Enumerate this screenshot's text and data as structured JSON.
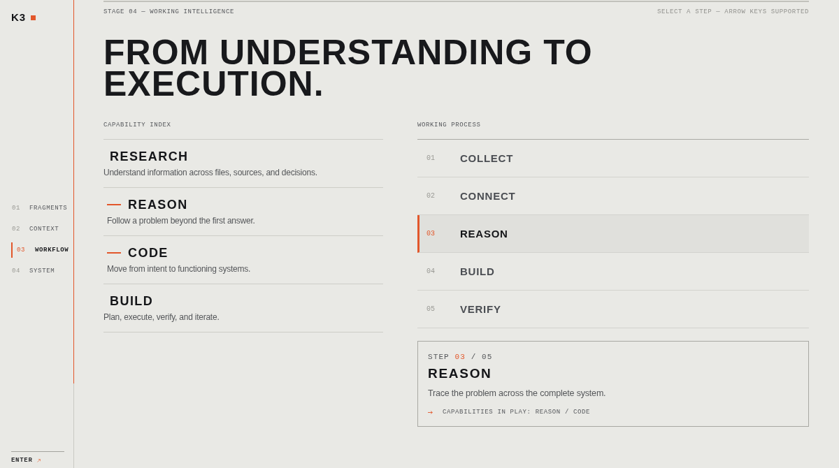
{
  "sidebar": {
    "brand": "K3",
    "nav": [
      {
        "number": "01",
        "label": "FRAGMENTS",
        "selected": false
      },
      {
        "number": "02",
        "label": "CONTEXT",
        "selected": false
      },
      {
        "number": "03",
        "label": "WORKFLOW",
        "selected": true
      },
      {
        "number": "04",
        "label": "SYSTEM",
        "selected": false
      }
    ],
    "footer_link": "ENTER",
    "progress": {
      "level": 0.82
    }
  },
  "header": {
    "stage": "STAGE 04 — WORKING INTELLIGENCE",
    "hint": "SELECT A STEP — ARROW KEYS SUPPORTED"
  },
  "headline": "FROM UNDERSTANDING TO EXECUTION.",
  "capability_index": {
    "title": "CAPABILITY INDEX",
    "items": [
      {
        "name": "RESEARCH",
        "description": "Understand information across files, sources, and decisions.",
        "active": false
      },
      {
        "name": "REASON",
        "description": "Follow a problem beyond the first answer.",
        "active": true
      },
      {
        "name": "CODE",
        "description": "Move from intent to functioning systems.",
        "active": true
      },
      {
        "name": "BUILD",
        "description": "Plan, execute, verify, and iterate.",
        "active": false
      }
    ]
  },
  "working_process": {
    "title": "WORKING PROCESS",
    "steps": [
      {
        "number": "01",
        "name": "COLLECT",
        "selected": false
      },
      {
        "number": "02",
        "name": "CONNECT",
        "selected": false
      },
      {
        "number": "03",
        "name": "REASON",
        "selected": true
      },
      {
        "number": "04",
        "name": "BUILD",
        "selected": false
      },
      {
        "number": "05",
        "name": "VERIFY",
        "selected": false
      }
    ]
  },
  "step_detail": {
    "prefix": "STEP",
    "current": "03",
    "total": "/ 05",
    "title": "REASON",
    "description": "Trace the problem across the complete system.",
    "capabilities": "CAPABILITIES IN PLAY: REASON / CODE"
  }
}
